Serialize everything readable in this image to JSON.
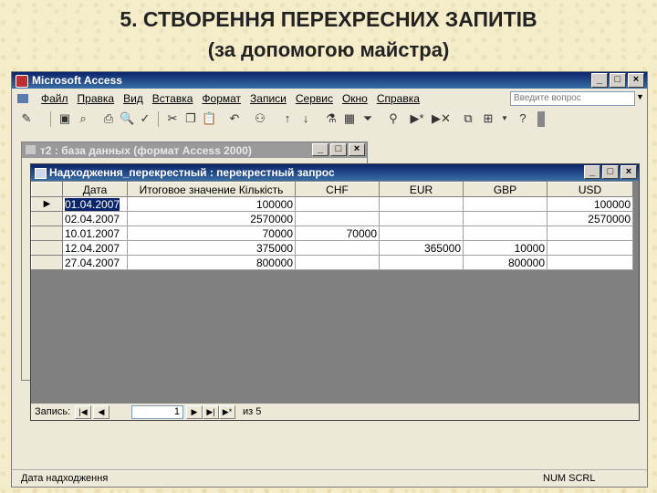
{
  "slide": {
    "title": "5. СТВОРЕННЯ ПЕРЕХРЕСНИХ ЗАПИТІВ",
    "subtitle": "(за допомогою майстра)"
  },
  "app": {
    "title": "Microsoft Access",
    "win_buttons": [
      "_",
      "□",
      "×"
    ],
    "menu": [
      "Файл",
      "Правка",
      "Вид",
      "Вставка",
      "Формат",
      "Записи",
      "Сервис",
      "Окно",
      "Справка"
    ],
    "help_placeholder": "Введите вопрос"
  },
  "db_window": {
    "title": "т2 : база данных (формат Access 2000)"
  },
  "query_window": {
    "title": "Надходження_перекрестный : перекрестный запрос",
    "columns": [
      "Дата",
      "Итоговое значение Кількість",
      "CHF",
      "EUR",
      "GBP",
      "USD"
    ],
    "rows": [
      [
        "01.04.2007",
        "100000",
        "",
        "",
        "",
        "100000"
      ],
      [
        "02.04.2007",
        "2570000",
        "",
        "",
        "",
        "2570000"
      ],
      [
        "10.01.2007",
        "70000",
        "70000",
        "",
        "",
        ""
      ],
      [
        "12.04.2007",
        "375000",
        "",
        "365000",
        "10000",
        ""
      ],
      [
        "27.04.2007",
        "800000",
        "",
        "",
        "800000",
        ""
      ]
    ],
    "record_label": "Запись:",
    "record_current": "1",
    "record_total": "из 5"
  },
  "statusbar": {
    "left": "Дата надходження",
    "right": "NUM  SCRL"
  }
}
